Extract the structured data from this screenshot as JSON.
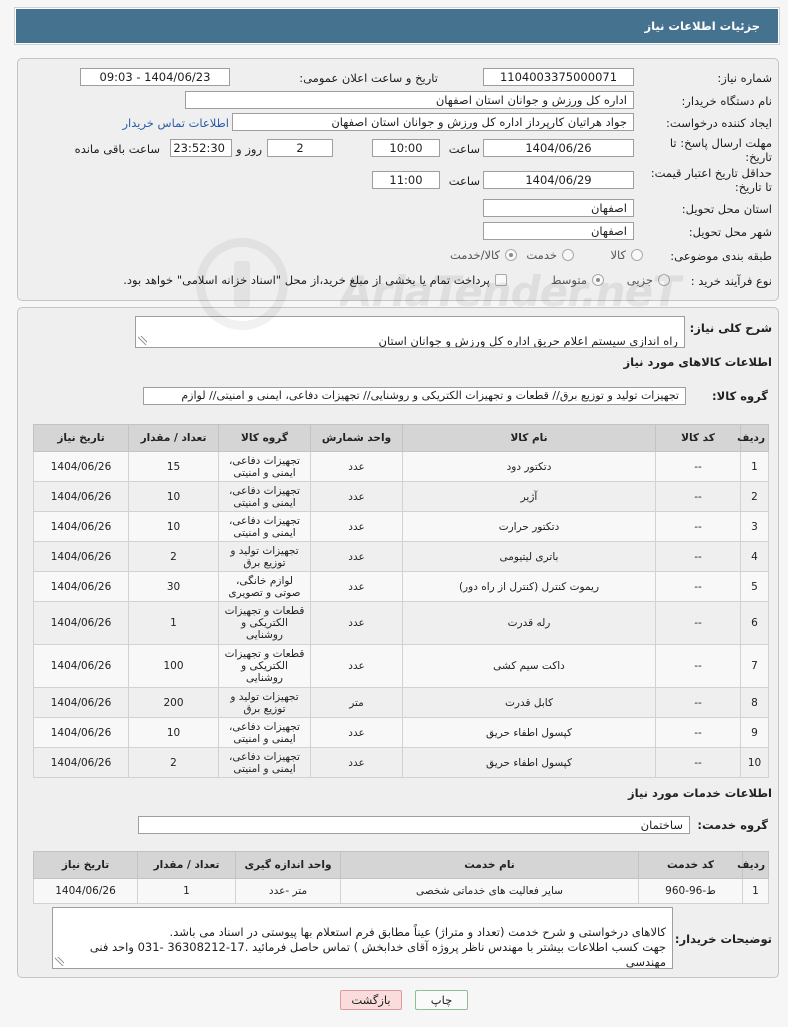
{
  "header": {
    "title": "جزئیات اطلاعات نیاز"
  },
  "info": {
    "need_number": {
      "label": "شماره نیاز:",
      "value": "1104003375000071"
    },
    "announce": {
      "label": "تاریخ و ساعت اعلان عمومی:",
      "value": "1404/06/23 - 09:03"
    },
    "buyer": {
      "label": "نام دستگاه خریدار:",
      "value": "اداره کل ورزش و جوانان استان اصفهان"
    },
    "creator": {
      "label": "ایجاد کننده درخواست:",
      "value": "جواد هراتیان کارپرداز اداره کل ورزش و جوانان استان اصفهان",
      "contact_link": "اطلاعات تماس خریدار"
    },
    "deadline": {
      "label": "مهلت ارسال پاسخ: تا\nتاریخ:",
      "date": "1404/06/26",
      "time_label": "ساعت",
      "time": "10:00",
      "days": "2",
      "days_label": "روز و",
      "remaining": "23:52:30",
      "remaining_label": "ساعت باقی مانده"
    },
    "validity": {
      "label": "حداقل تاریخ اعتبار قیمت:\nتا تاریخ:",
      "date": "1404/06/29",
      "time_label": "ساعت",
      "time": "11:00"
    },
    "province": {
      "label": "استان محل تحویل:",
      "value": "اصفهان"
    },
    "city": {
      "label": "شهر محل تحویل:",
      "value": "اصفهان"
    },
    "category": {
      "label": "طبقه بندی موضوعی:",
      "options": [
        {
          "label": "کالا",
          "checked": false
        },
        {
          "label": "خدمت",
          "checked": false
        },
        {
          "label": "کالا/خدمت",
          "checked": true
        }
      ]
    },
    "process": {
      "label": "نوع فرآیند خرید :",
      "options": [
        {
          "label": "جزیی",
          "checked": false
        },
        {
          "label": "متوسط",
          "checked": true
        }
      ],
      "treasury": {
        "label": "پرداخت تمام یا بخشی از مبلغ خرید،از محل \"اسناد خزانه اسلامی\" خواهد بود.",
        "checked": false
      }
    }
  },
  "description": {
    "label": "شرح کلی نیاز:",
    "value": "راه اندازی سیستم اعلام حریق اداره کل ورزش و جوانان استان"
  },
  "goods": {
    "title": "اطلاعات کالاهای مورد نیاز",
    "group_label": "گروه کالا:",
    "group_value": "تجهیزات تولید و توزیع برق// قطعات و تجهیزات الکتریکی و روشنایی// تجهیزات دفاعی، ایمنی و امنیتی// لوازم",
    "columns": [
      "ردیف",
      "کد کالا",
      "نام کالا",
      "واحد شمارش",
      "گروه کالا",
      "تعداد / مقدار",
      "تاریخ نیاز"
    ],
    "rows": [
      {
        "row": "1",
        "code": "--",
        "name": "دتکتور دود",
        "unit": "عدد",
        "group": "تجهیزات دفاعی، ایمنی و امنیتی",
        "qty": "15",
        "date": "1404/06/26"
      },
      {
        "row": "2",
        "code": "--",
        "name": "آژیر",
        "unit": "عدد",
        "group": "تجهیزات دفاعی، ایمنی و امنیتی",
        "qty": "10",
        "date": "1404/06/26"
      },
      {
        "row": "3",
        "code": "--",
        "name": "دتکتور حرارت",
        "unit": "عدد",
        "group": "تجهیزات دفاعی، ایمنی و امنیتی",
        "qty": "10",
        "date": "1404/06/26"
      },
      {
        "row": "4",
        "code": "--",
        "name": "باتری لیتیومی",
        "unit": "عدد",
        "group": "تجهیزات تولید و توزیع برق",
        "qty": "2",
        "date": "1404/06/26"
      },
      {
        "row": "5",
        "code": "--",
        "name": "ریموت کنترل (کنترل از راه دور)",
        "unit": "عدد",
        "group": "لوازم خانگی، صوتی و تصویری",
        "qty": "30",
        "date": "1404/06/26"
      },
      {
        "row": "6",
        "code": "--",
        "name": "رله قدرت",
        "unit": "عدد",
        "group": "قطعات و تجهیزات الکتریکی و روشنایی",
        "qty": "1",
        "date": "1404/06/26"
      },
      {
        "row": "7",
        "code": "--",
        "name": "داکت سیم کشی",
        "unit": "عدد",
        "group": "قطعات و تجهیزات الکتریکی و روشنایی",
        "qty": "100",
        "date": "1404/06/26"
      },
      {
        "row": "8",
        "code": "--",
        "name": "کابل قدرت",
        "unit": "متر",
        "group": "تجهیزات تولید و توزیع برق",
        "qty": "200",
        "date": "1404/06/26"
      },
      {
        "row": "9",
        "code": "--",
        "name": "کپسول اطفاء حریق",
        "unit": "عدد",
        "group": "تجهیزات دفاعی، ایمنی و امنیتی",
        "qty": "10",
        "date": "1404/06/26"
      },
      {
        "row": "10",
        "code": "--",
        "name": "کپسول اطفاء حریق",
        "unit": "عدد",
        "group": "تجهیزات دفاعی، ایمنی و امنیتی",
        "qty": "2",
        "date": "1404/06/26"
      }
    ]
  },
  "services": {
    "title": "اطلاعات خدمات مورد نیاز",
    "group_label": "گروه خدمت:",
    "group_value": "ساختمان",
    "columns": [
      "ردیف",
      "کد خدمت",
      "نام خدمت",
      "واحد اندازه گیری",
      "تعداد / مقدار",
      "تاریخ نیاز"
    ],
    "rows": [
      {
        "row": "1",
        "code": "ط-96-960",
        "name": "سایر فعالیت های خدماتی شخصی",
        "unit": "متر -عدد",
        "qty": "1",
        "date": "1404/06/26"
      }
    ]
  },
  "buyer_notes": {
    "label": "توضیحات خریدار:",
    "value": "کالاهای درخواستی و شرح خدمت (تعداد و متراژ) عیناً مطابق فرم استعلام بها پیوستی در اسناد می باشد.\nجهت کسب اطلاعات بیشتر با مهندس ناظر پروژه آقای خدابخش ) تماس حاصل فرمائید .17-36308212 -031 واحد فنی مهندسی"
  },
  "buttons": {
    "print": "چاپ",
    "back": "بازگشت"
  },
  "watermark": {
    "text": "AriaTender.neT"
  },
  "colors": {
    "header_bg": "#44728f",
    "link": "#2a5caa",
    "table_header_bg": "#d5d5d5",
    "back_bg": "#fbdcdc",
    "back_border": "#e39a9a",
    "print_border": "#8fbf8f"
  }
}
